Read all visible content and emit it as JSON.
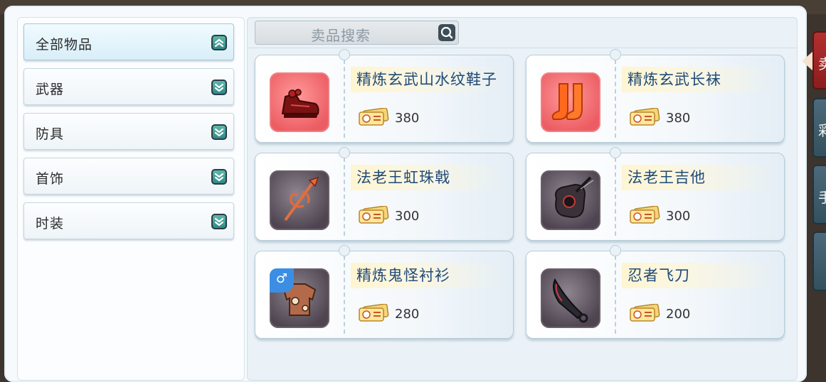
{
  "search": {
    "placeholder": "卖品搜索",
    "icon": "search-icon"
  },
  "sidebar": {
    "categories": [
      {
        "label": "全部物品",
        "state": "expanded"
      },
      {
        "label": "武器",
        "state": "collapsed"
      },
      {
        "label": "防具",
        "state": "collapsed"
      },
      {
        "label": "首饰",
        "state": "collapsed"
      },
      {
        "label": "时装",
        "state": "collapsed"
      }
    ]
  },
  "items": [
    {
      "name": "精炼玄武山水纹鞋子",
      "price": "380",
      "icon": "shoes-icon",
      "tile": "red"
    },
    {
      "name": "精炼玄武长袜",
      "price": "380",
      "icon": "socks-icon",
      "tile": "red"
    },
    {
      "name": "法老王虹珠戟",
      "price": "300",
      "icon": "halberd-icon",
      "tile": "dark"
    },
    {
      "name": "法老王吉他",
      "price": "300",
      "icon": "guitar-icon",
      "tile": "dark"
    },
    {
      "name": "精炼鬼怪衬衫",
      "price": "280",
      "icon": "shirt-icon",
      "tile": "dark",
      "badge": "♂"
    },
    {
      "name": "忍者飞刀",
      "price": "200",
      "icon": "dagger-icon",
      "tile": "dark"
    }
  ],
  "side_tabs": [
    {
      "label": "卖",
      "active": true
    },
    {
      "label": "彩",
      "active": false
    },
    {
      "label": "手",
      "active": false
    },
    {
      "label": "",
      "active": false
    }
  ],
  "colors": {
    "accent": "#2d8a86",
    "item_name": "#1f4a78",
    "active_tab": "#b4302f"
  }
}
